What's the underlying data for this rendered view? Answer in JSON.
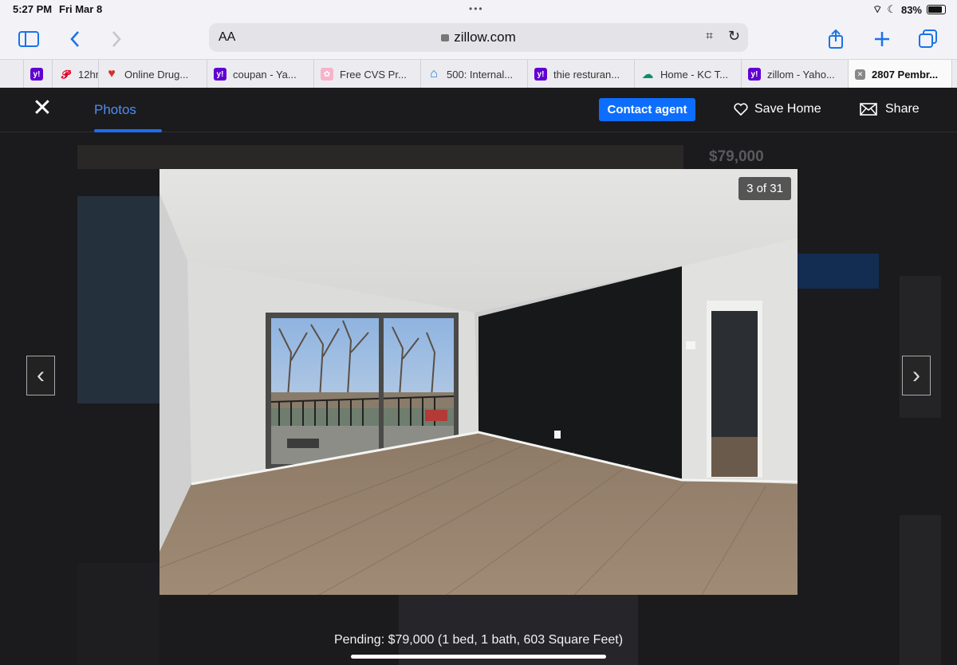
{
  "status": {
    "time": "5:27 PM",
    "date": "Fri Mar 8",
    "battery": "83%"
  },
  "browser": {
    "aa_label": "AA",
    "url": "zillow.com"
  },
  "tabs": [
    {
      "label": "12hr",
      "favicon": "pinterest-icon",
      "color": "#e60023"
    },
    {
      "label": "Online Drug...",
      "favicon": "heart-icon",
      "color": "#d32f2f"
    },
    {
      "label": "coupan - Ya...",
      "favicon": "yahoo-icon",
      "color": "#6001d2"
    },
    {
      "label": "Free CVS Pr...",
      "favicon": "cvs-icon",
      "color": "#f27aa0"
    },
    {
      "label": "500: Internal...",
      "favicon": "zillow-icon",
      "color": "#1277e1"
    },
    {
      "label": "thie resturan...",
      "favicon": "yahoo-icon",
      "color": "#6001d2"
    },
    {
      "label": "Home - KC T...",
      "favicon": "cloud-icon",
      "color": "#0a8f6d"
    },
    {
      "label": "zillom - Yaho...",
      "favicon": "yahoo-icon",
      "color": "#6001d2"
    },
    {
      "label": "2807 Pembr...",
      "favicon": "close-icon",
      "color": "#888888",
      "active": true
    }
  ],
  "gallery": {
    "photos_tab": "Photos",
    "contact_agent": "Contact agent",
    "save_home": "Save Home",
    "share": "Share",
    "counter": "3 of 31",
    "caption": "Pending: $79,000 (1 bed, 1 bath, 603 Square Feet)"
  },
  "background_page": {
    "price": "$79,000"
  },
  "colors": {
    "accent": "#0d6efd",
    "overlay": "#1b1b1d"
  }
}
